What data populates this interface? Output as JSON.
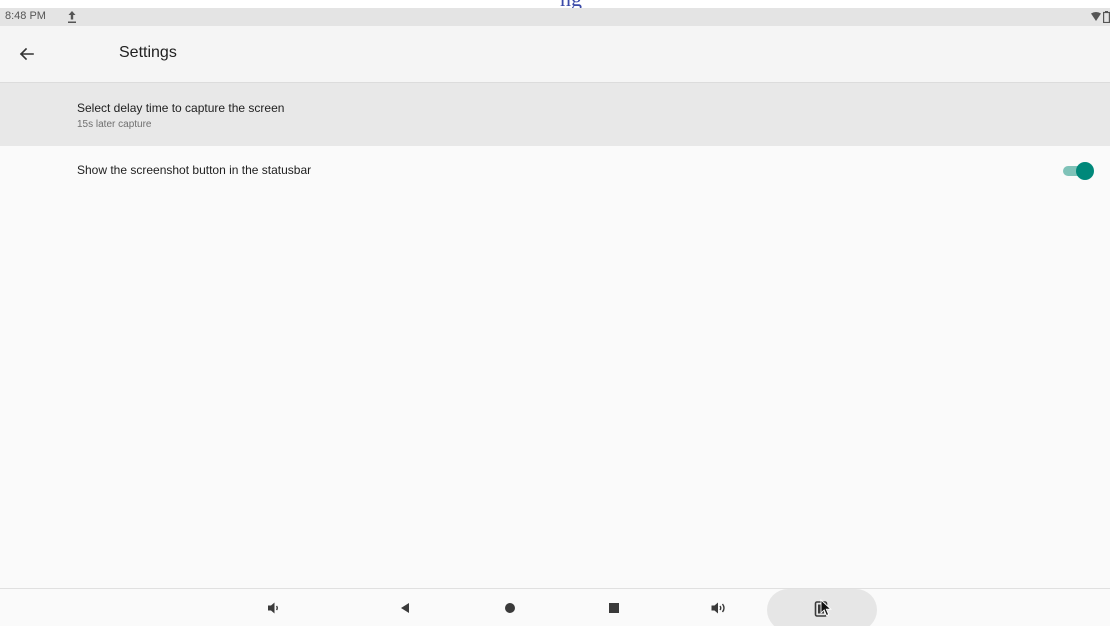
{
  "top_strip": {
    "text": "ng"
  },
  "status_bar": {
    "time": "8:48 PM",
    "icons": [
      "upload-icon",
      "wifi-icon",
      "battery-icon"
    ]
  },
  "app_bar": {
    "title": "Settings",
    "back_icon": "arrow-back-icon"
  },
  "preferences": [
    {
      "title": "Select delay time to capture the screen",
      "summary": "15s later capture"
    },
    {
      "title": "Show the screenshot button in the statusbar",
      "switch_on": true
    }
  ],
  "colors": {
    "accent": "#00887a",
    "accent_track": "#7fc2b8",
    "selected_row": "#e8e8e8",
    "status_bar": "#e4e4e4"
  },
  "nav_bar": {
    "buttons": [
      "volume-down-icon",
      "back-triangle-icon",
      "home-circle-icon",
      "recents-square-icon",
      "volume-up-icon",
      "screenshot-icon"
    ]
  }
}
